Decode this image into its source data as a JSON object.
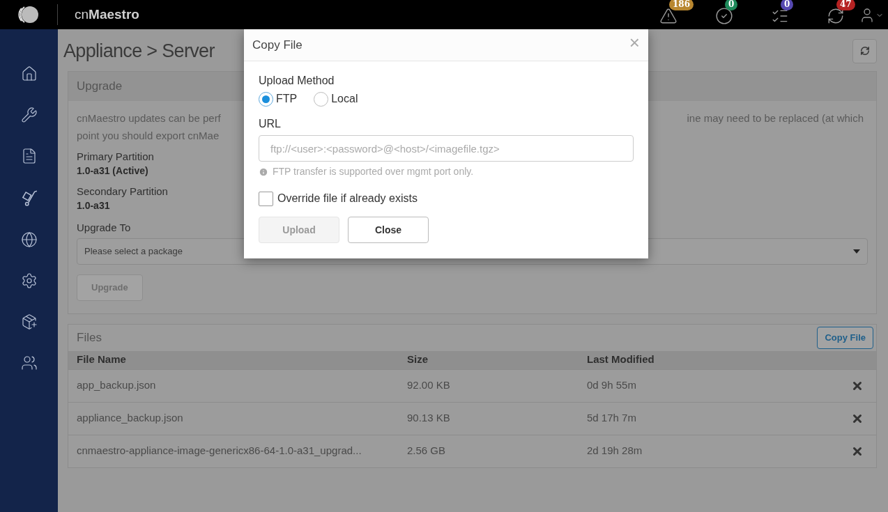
{
  "header": {
    "brand": "cn**Maestro**",
    "badges": [
      {
        "count": "186",
        "color": "#b8862f"
      },
      {
        "count": "0",
        "color": "#1f8a5b"
      },
      {
        "count": "0",
        "color": "#5548b0"
      },
      {
        "count": "47",
        "color": "#b52222"
      }
    ]
  },
  "page": {
    "title": "Appliance > Server"
  },
  "upgrade": {
    "title": "Upgrade",
    "text_left": [
      "cnMaestro updates can be perf",
      "point you should export cnMae"
    ],
    "text_right": "ine may need to be replaced (at which",
    "fields": [
      {
        "label": "Primary Partition",
        "value": "1.0-a31 (Active)"
      },
      {
        "label": "Secondary Partition",
        "value": "1.0-a31"
      }
    ],
    "upgrade_to": {
      "label": "Upgrade To",
      "placeholder": "Please select a package"
    },
    "button": {
      "label": "Upgrade",
      "disabled": true
    }
  },
  "files": {
    "title": "Files",
    "copy_button": "Copy File",
    "columns": [
      "File Name",
      "Size",
      "Last Modified"
    ],
    "rows": [
      {
        "name": "app_backup.json",
        "size": "92.00 KB",
        "modified": "0d 9h 55m"
      },
      {
        "name": "appliance_backup.json",
        "size": "90.13 KB",
        "modified": "5d 17h 7m"
      },
      {
        "name": "cnmaestro-appliance-image-genericx86-64-1.0-a31_upgrad...",
        "size": "2.56 GB",
        "modified": "2d 19h 28m"
      }
    ]
  },
  "dialog": {
    "title": "Copy File",
    "close": "×",
    "method_label": "Upload Method",
    "methods": [
      {
        "label": "FTP",
        "selected": true
      },
      {
        "label": "Local",
        "selected": false
      }
    ],
    "url_label": "URL",
    "url_placeholder": "ftp://<user>:<password>@<host>/<imagefile.tgz>",
    "hint": "FTP transfer is supported over mgmt port only.",
    "override": {
      "label": "Override file if already exists",
      "checked": false
    },
    "buttons": [
      {
        "label": "Upload",
        "disabled": true
      },
      {
        "label": "Close",
        "disabled": false
      }
    ]
  }
}
